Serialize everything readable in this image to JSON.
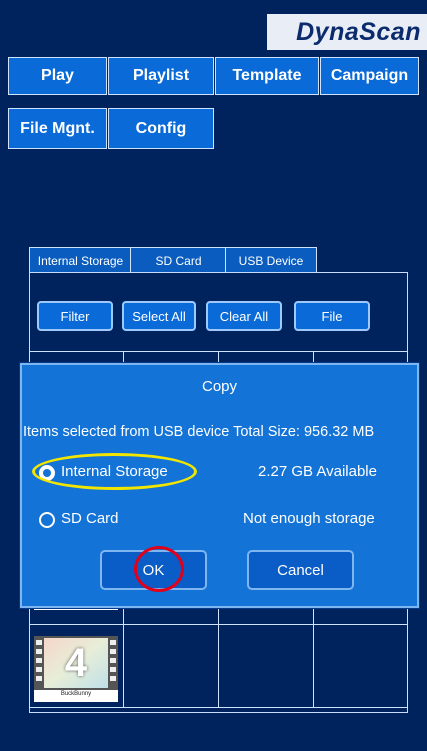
{
  "brand": "DynaScan",
  "nav": {
    "play": "Play",
    "playlist": "Playlist",
    "template": "Template",
    "campaign": "Campaign",
    "file_mgmt": "File Mgnt.",
    "config": "Config"
  },
  "storage_tabs": [
    "Internal Storage",
    "SD Card",
    "USB Device"
  ],
  "actions": {
    "filter": "Filter",
    "select_all": "Select All",
    "clear_all": "Clear All",
    "file": "File"
  },
  "thumbnail": {
    "number": "4",
    "caption": "BuckBunny"
  },
  "dialog": {
    "title": "Copy",
    "info": "Items selected from USB device  Total Size: 956.32 MB",
    "options": [
      {
        "label": "Internal Storage",
        "status": "2.27 GB Available",
        "selected": true
      },
      {
        "label": "SD Card",
        "status": "Not enough storage",
        "selected": false
      }
    ],
    "ok_label": "OK",
    "cancel_label": "Cancel"
  },
  "colors": {
    "background": "#00235e",
    "button": "#0a6ad8",
    "dialog": "#1373d6",
    "highlight_yellow": "#f2e600",
    "highlight_red": "#e0001a"
  }
}
